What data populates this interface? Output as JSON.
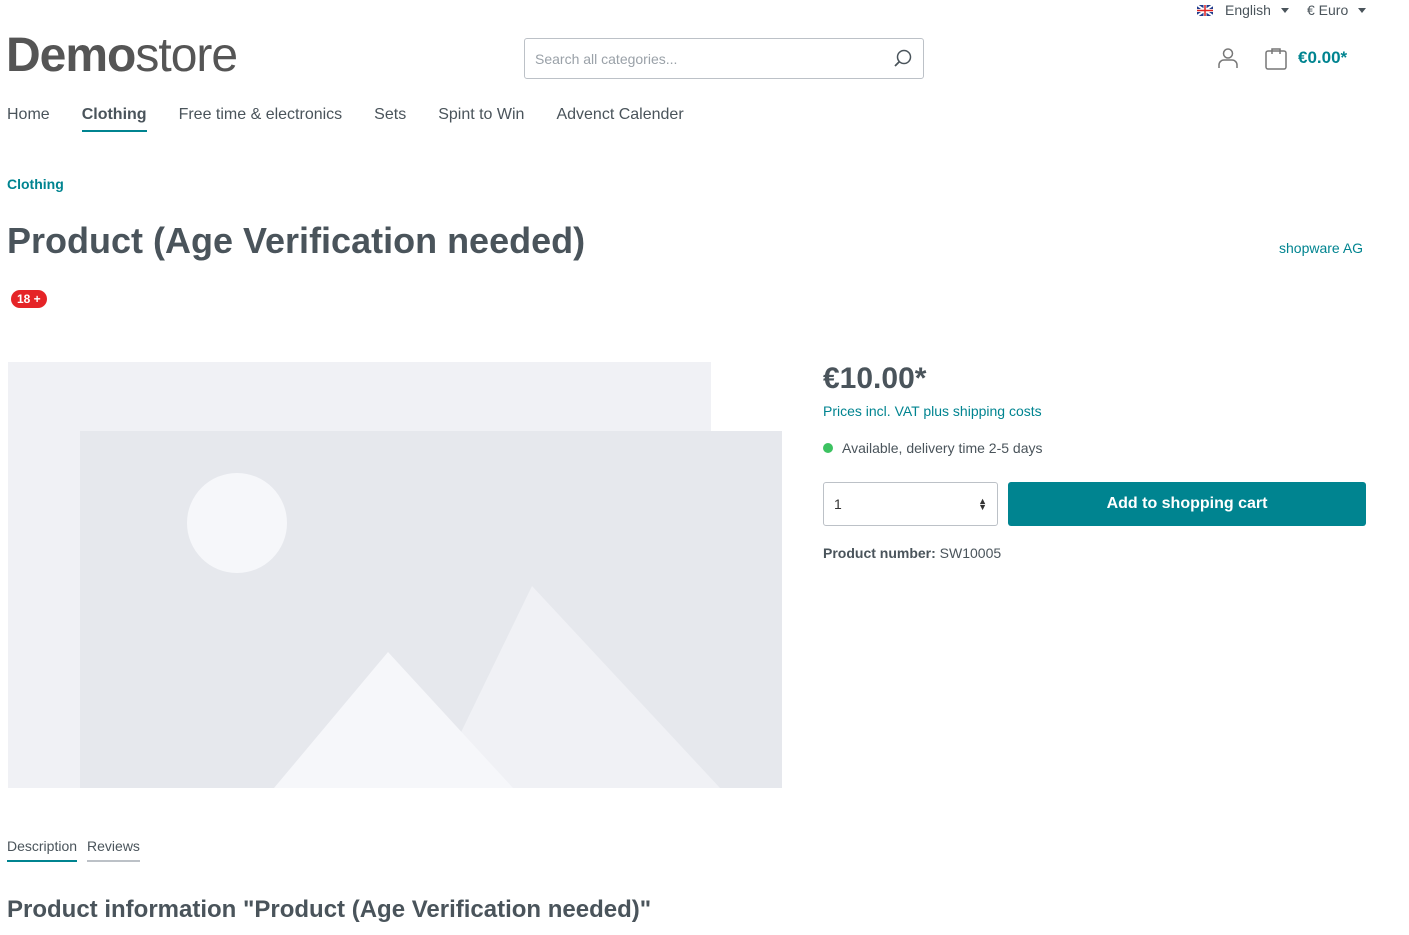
{
  "topbar": {
    "language": "English",
    "currency": "€ Euro"
  },
  "logo": {
    "bold": "Demo",
    "light": "store"
  },
  "search": {
    "placeholder": "Search all categories..."
  },
  "cart": {
    "total": "€0.00*"
  },
  "nav": [
    "Home",
    "Clothing",
    "Free time & electronics",
    "Sets",
    "Spint to Win",
    "Advenct Calender"
  ],
  "breadcrumb": "Clothing",
  "product": {
    "title": "Product (Age Verification needed)",
    "manufacturer": "shopware AG",
    "badge": "18 +",
    "price": "€10.00*",
    "tax_note": "Prices incl. VAT plus shipping costs",
    "availability": "Available, delivery time 2-5 days",
    "quantity": "1",
    "add_to_cart": "Add to shopping cart",
    "number_label": "Product number:",
    "number": "SW10005"
  },
  "tabs": [
    "Description",
    "Reviews"
  ],
  "info_title": "Product information \"Product (Age Verification needed)\"",
  "colors": {
    "accent": "#008490",
    "badge": "#e52427",
    "available": "#3cc261"
  }
}
